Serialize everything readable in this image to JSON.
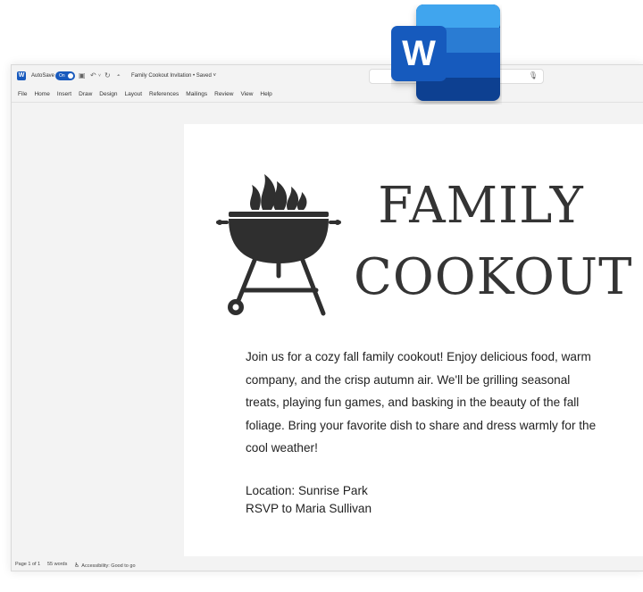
{
  "titlebar": {
    "autosave_label": "AutoSave",
    "autosave_state": "On",
    "document_title": "Family Cookout Invitation • Saved ˅"
  },
  "app_logo_letter": "W",
  "menu": [
    "File",
    "Home",
    "Insert",
    "Draw",
    "Design",
    "Layout",
    "References",
    "Mailings",
    "Review",
    "View",
    "Help"
  ],
  "document": {
    "heading_line1": "FAMILY",
    "heading_line2": "COOKOUT",
    "body": "Join us for a cozy fall family cookout! Enjoy delicious food, warm company, and the crisp autumn air. We'll be grilling seasonal treats, playing fun games, and basking in the beauty of the fall foliage. Bring your favorite dish to share and dress warmly for the cool weather!",
    "location": "Location: Sunrise Park",
    "rsvp": "RSVP to Maria Sullivan"
  },
  "status": {
    "page": "Page 1 of 1",
    "words": "55 words",
    "accessibility": "Accessibility: Good to go"
  },
  "colors": {
    "word_blue": "#185abd",
    "heading": "#343434",
    "grill": "#2f2f2f"
  },
  "icons": [
    "word-logo-icon",
    "save-icon",
    "undo-icon",
    "redo-icon",
    "customize-icon",
    "microphone-icon",
    "accessibility-icon",
    "grill-icon"
  ]
}
